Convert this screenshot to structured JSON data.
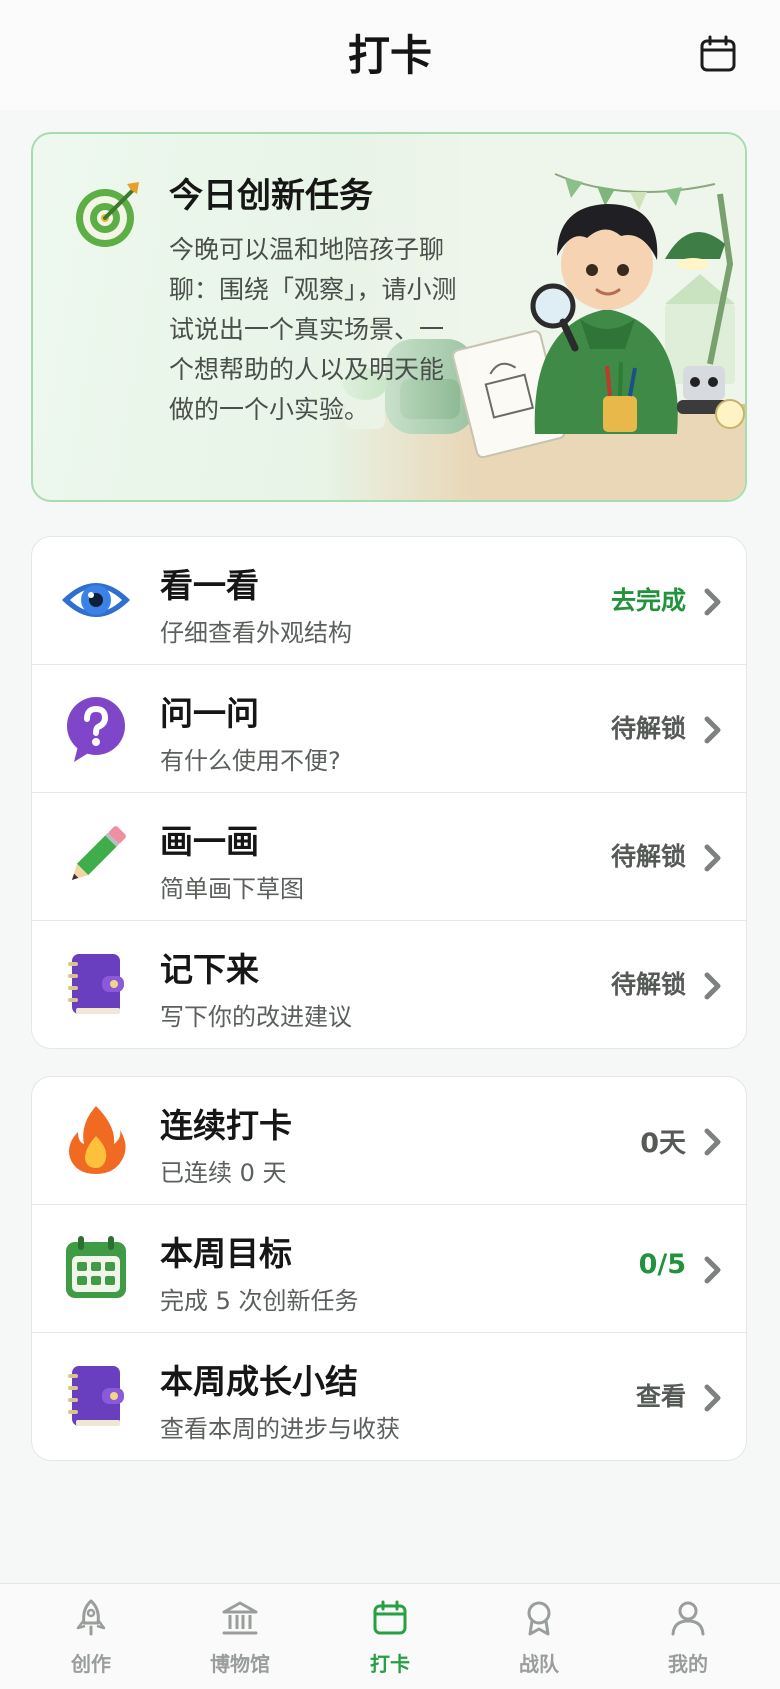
{
  "header": {
    "title": "打卡",
    "calendar_icon": "calendar-icon"
  },
  "hero": {
    "title": "今日创新任务",
    "text": "今晚可以温和地陪孩子聊聊：围绕「观察」，请小测试说出一个真实场景、一个想帮助的人以及明天能做的一个小实验。",
    "icon": "target-icon",
    "accent": "#a8dcb0"
  },
  "tasks": [
    {
      "title": "看一看",
      "subtitle": "仔细查看外观结构",
      "status": "去完成",
      "icon": "eye-icon"
    },
    {
      "title": "问一问",
      "subtitle": "有什么使用不便?",
      "status": "待解锁",
      "icon": "question-icon"
    },
    {
      "title": "画一画",
      "subtitle": "简单画下草图",
      "status": "待解锁",
      "icon": "pencil-icon"
    },
    {
      "title": "记下来",
      "subtitle": "写下你的改进建议",
      "status": "待解锁",
      "icon": "notebook-icon"
    }
  ],
  "stats": [
    {
      "title": "连续打卡",
      "subtitle": "已连续 0 天",
      "status": "0天",
      "icon": "flame-icon"
    },
    {
      "title": "本周目标",
      "subtitle": "完成 5 次创新任务",
      "status": "0/5",
      "icon": "calendar-grid-icon"
    },
    {
      "title": "本周成长小结",
      "subtitle": "查看本周的进步与收获",
      "status": "查看",
      "icon": "notebook-icon"
    }
  ],
  "tabs": [
    {
      "label": "创作",
      "icon": "rocket-icon"
    },
    {
      "label": "博物馆",
      "icon": "museum-icon"
    },
    {
      "label": "打卡",
      "icon": "calendar-icon",
      "active": true
    },
    {
      "label": "战队",
      "icon": "badge-icon"
    },
    {
      "label": "我的",
      "icon": "user-icon"
    }
  ],
  "colors": {
    "accent_green": "#23923d",
    "tab_active": "#27a043",
    "tab_inactive": "#9a9e9b"
  }
}
